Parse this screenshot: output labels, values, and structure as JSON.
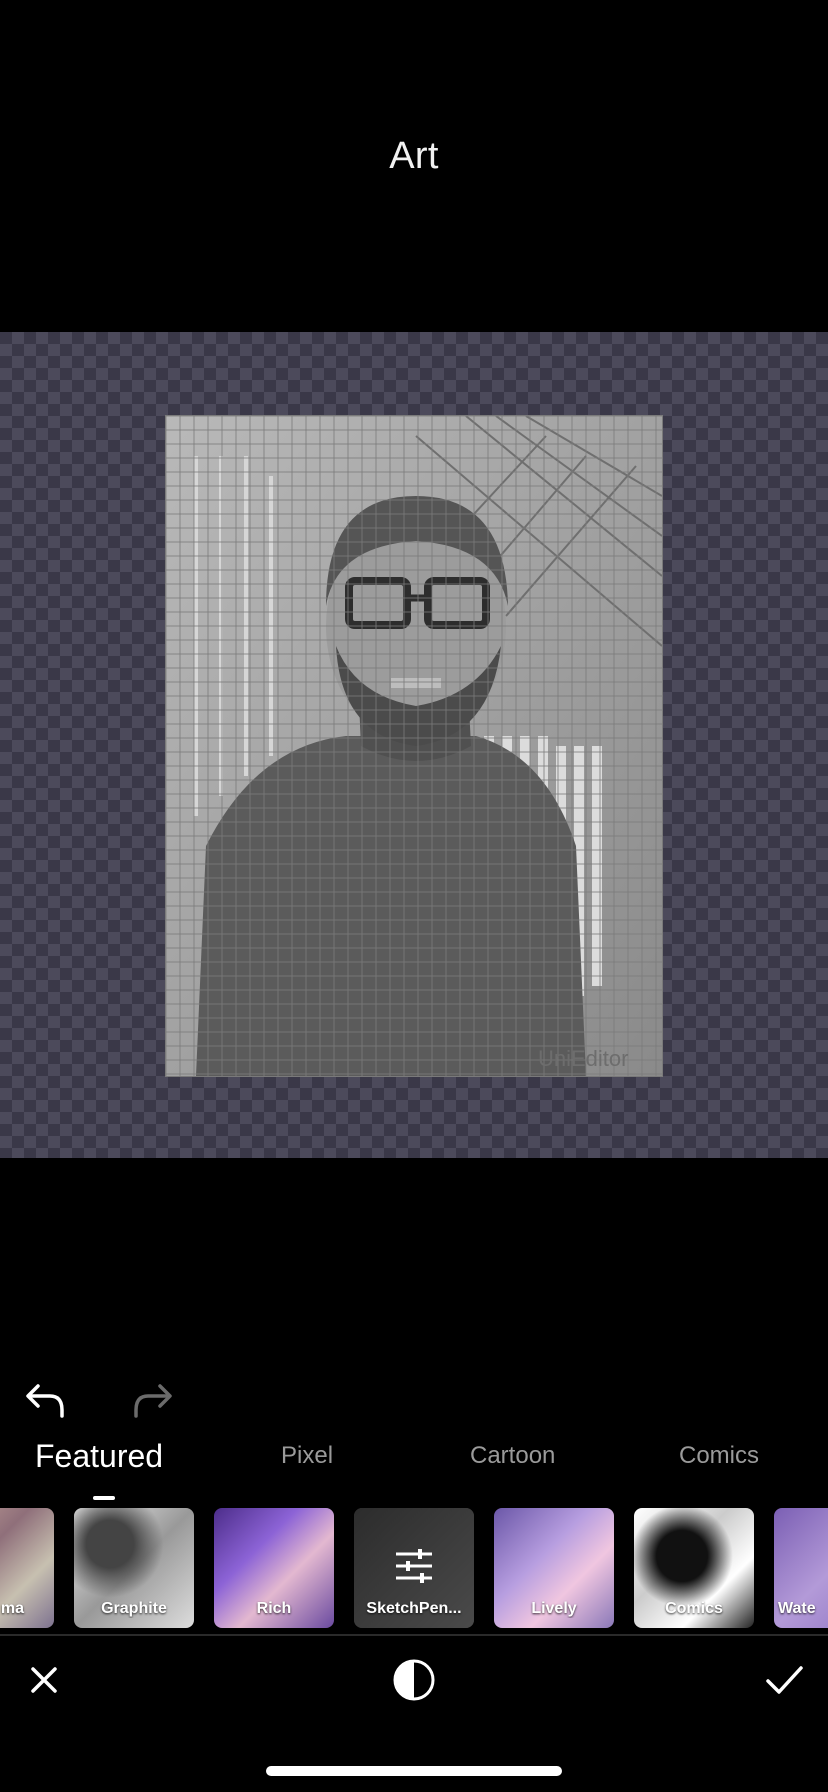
{
  "header": {
    "title": "Art"
  },
  "canvas": {
    "watermark": "UniEditor"
  },
  "history": {
    "undo_icon": "undo-icon",
    "redo_icon": "redo-icon"
  },
  "tabs": [
    {
      "label": "Featured",
      "active": true
    },
    {
      "label": "Pixel",
      "active": false
    },
    {
      "label": "Cartoon",
      "active": false
    },
    {
      "label": "Comics",
      "active": false
    }
  ],
  "effects": [
    {
      "label": "ma",
      "style": "color"
    },
    {
      "label": "Graphite",
      "style": "graphite"
    },
    {
      "label": "Rich",
      "style": "rich"
    },
    {
      "label": "SketchPen...",
      "style": "adjust",
      "selected": true
    },
    {
      "label": "Lively",
      "style": "lively"
    },
    {
      "label": "Comics",
      "style": "comics"
    },
    {
      "label": "Wate",
      "style": "water"
    }
  ],
  "bottom_bar": {
    "cancel_icon": "close-icon",
    "compare_icon": "contrast-icon",
    "apply_icon": "check-icon"
  },
  "colors": {
    "background": "#000000",
    "checker_dark": "#3a3848",
    "checker_light": "#4c4a5b",
    "inactive_tab": "#9a9a9a"
  }
}
